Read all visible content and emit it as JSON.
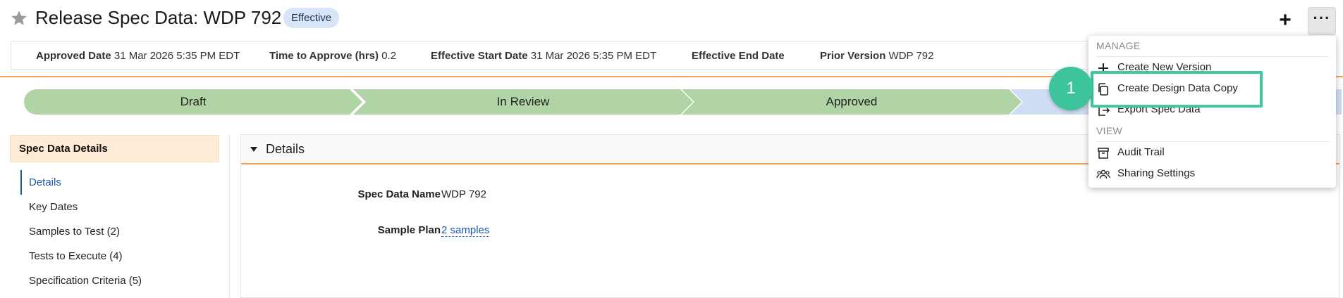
{
  "header": {
    "title": "Release Spec Data: WDP 792",
    "status_badge": "Effective"
  },
  "meta": {
    "approved_date_label": "Approved Date",
    "approved_date_value": "31 Mar 2026 5:35 PM EDT",
    "time_to_approve_label": "Time to Approve (hrs)",
    "time_to_approve_value": "0.2",
    "effective_start_label": "Effective Start Date",
    "effective_start_value": "31 Mar 2026 5:35 PM EDT",
    "effective_end_label": "Effective End Date",
    "effective_end_value": "",
    "prior_version_label": "Prior Version",
    "prior_version_value": "WDP 792"
  },
  "lifecycle": {
    "steps": [
      {
        "label": "Draft",
        "state": "complete"
      },
      {
        "label": "In Review",
        "state": "complete"
      },
      {
        "label": "Approved",
        "state": "complete"
      },
      {
        "label": "",
        "state": "current"
      }
    ]
  },
  "sidebar": {
    "heading": "Spec Data Details",
    "items": [
      {
        "label": "Details",
        "active": true
      },
      {
        "label": "Key Dates",
        "active": false
      },
      {
        "label": "Samples to Test (2)",
        "active": false
      },
      {
        "label": "Tests to Execute (4)",
        "active": false
      },
      {
        "label": "Specification Criteria (5)",
        "active": false
      }
    ]
  },
  "details": {
    "section_title": "Details",
    "fields": [
      {
        "label": "Spec Data Name",
        "value": "WDP 792",
        "is_link": false
      },
      {
        "label": "Sample Plan",
        "value": "2 samples",
        "is_link": true
      }
    ]
  },
  "actions_menu": {
    "manage_heading": "MANAGE",
    "manage_items": [
      {
        "label": "Create New Version",
        "icon": "plus-icon"
      },
      {
        "label": "Create Design Data Copy",
        "icon": "copy-icon"
      },
      {
        "label": "Export Spec Data",
        "icon": "export-icon"
      }
    ],
    "view_heading": "VIEW",
    "view_items": [
      {
        "label": "Audit Trail",
        "icon": "archive-icon"
      },
      {
        "label": "Sharing Settings",
        "icon": "people-icon"
      }
    ]
  },
  "annotation": {
    "step_number": "1"
  },
  "colors": {
    "step_complete": "#b0d4a6",
    "step_current": "#cfdef5",
    "accent_orange": "#f2a15a",
    "link_blue": "#1a5aa8",
    "highlight_green": "#3cc8a0"
  }
}
